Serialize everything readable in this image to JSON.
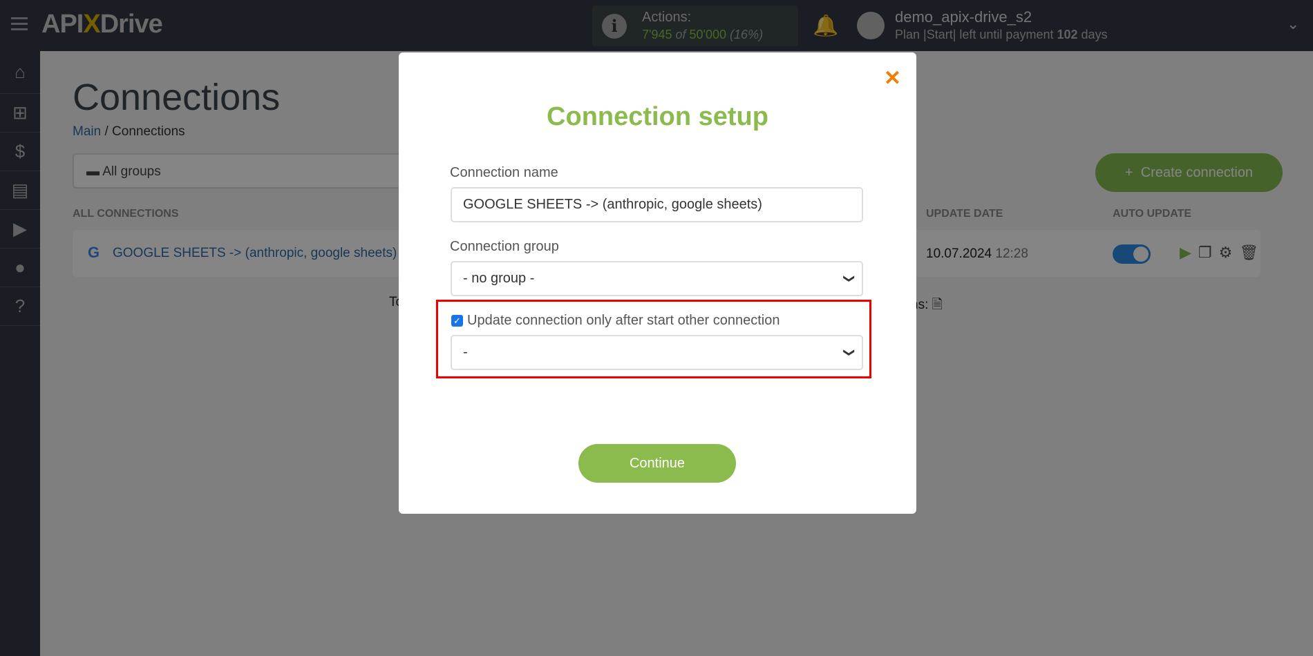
{
  "header": {
    "logo": "APIXDrive",
    "actions_label": "Actions:",
    "actions_used": "7'945",
    "actions_of": "of",
    "actions_total": "50'000",
    "actions_pct": "(16%)",
    "username": "demo_apix-drive_s2",
    "plan": "Plan |Start| left until payment",
    "days": "102",
    "days_suffix": "days"
  },
  "sidebar": [
    "home-icon",
    "sitemap-icon",
    "dollar-icon",
    "briefcase-icon",
    "youtube-icon",
    "user-icon",
    "help-icon"
  ],
  "page": {
    "title": "Connections",
    "breadcrumb_main": "Main",
    "breadcrumb_sep": "/",
    "breadcrumb_current": "Connections",
    "groups": "All groups",
    "create": "Create connection",
    "col_all": "ALL CONNECTIONS",
    "col_date": "UPDATE DATE",
    "col_auto": "AUTO UPDATE",
    "row": {
      "name": "GOOGLE SHEETS -> (anthropic, google sheets)",
      "date": "10.07.2024",
      "time": "12:28",
      "auto_update": true
    },
    "footer_left": "To",
    "footer_right": "ns:"
  },
  "modal": {
    "title": "Connection setup",
    "name_label": "Connection name",
    "name_value": "GOOGLE SHEETS -> (anthropic, google sheets)",
    "group_label": "Connection group",
    "group_value": "- no group -",
    "checkbox_label": "Update connection only after start other connection",
    "checkbox_checked": true,
    "after_value": "-",
    "continue": "Continue"
  },
  "colors": {
    "accent": "#8bbb4c",
    "close": "#f57c00",
    "highlight": "#ee0000"
  }
}
